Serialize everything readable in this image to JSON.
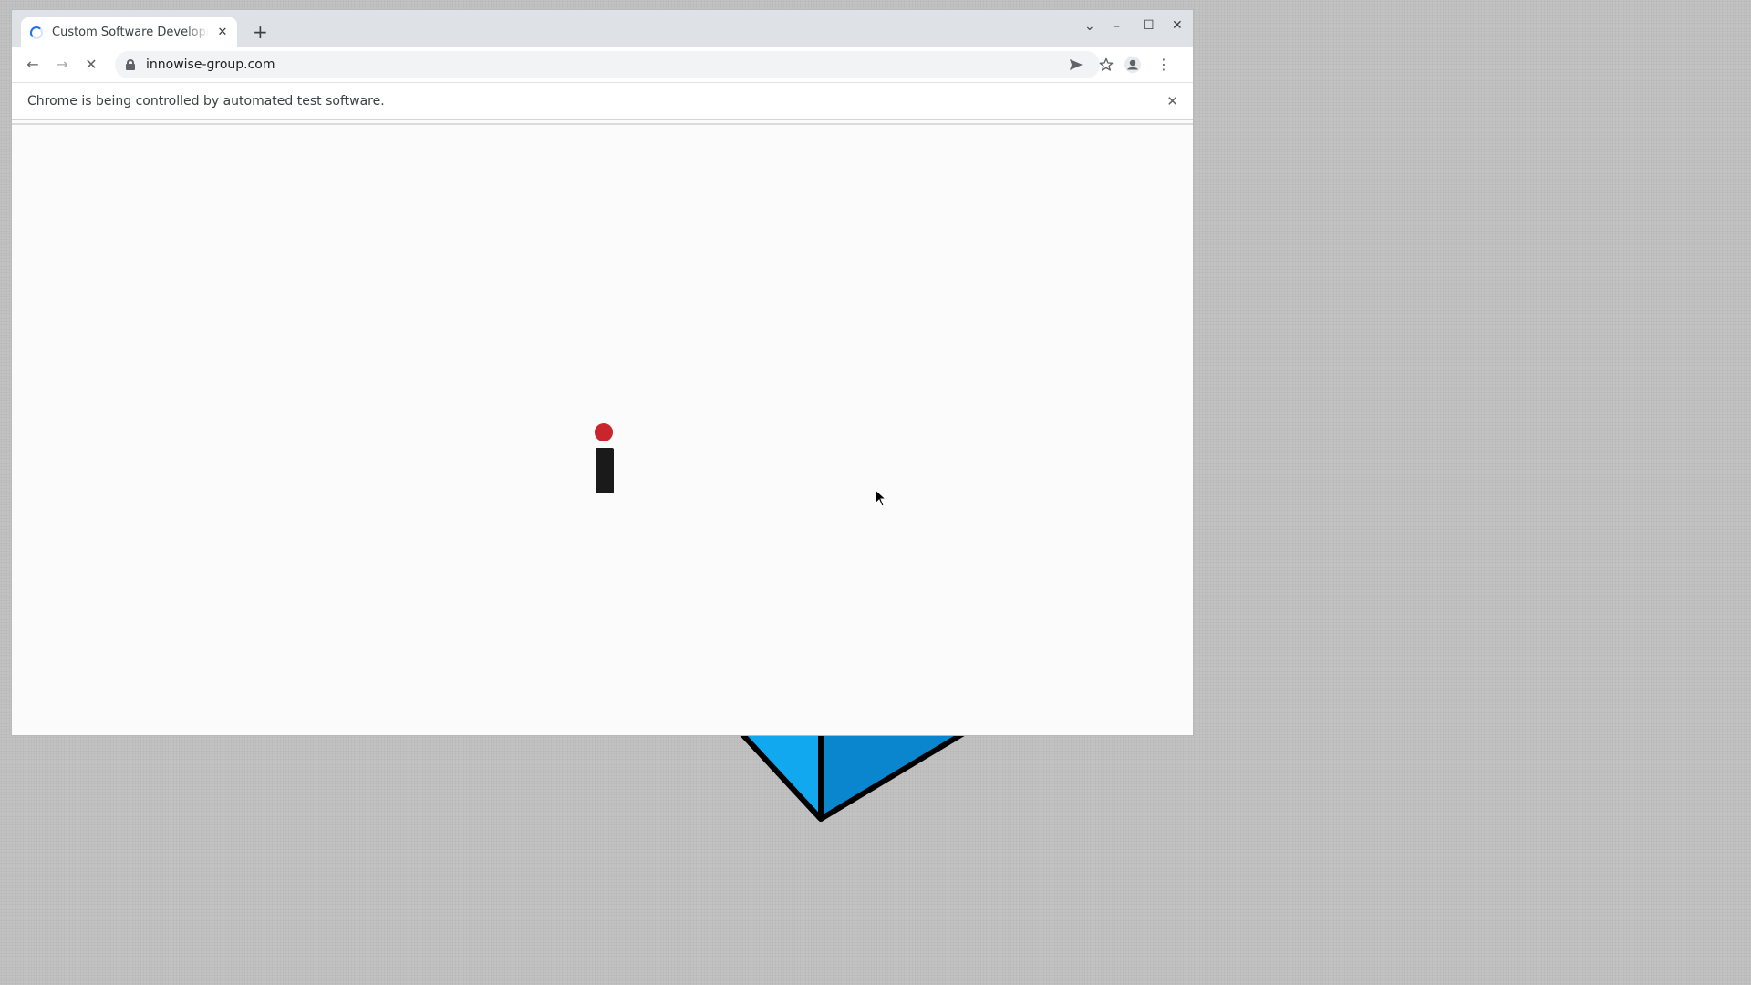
{
  "browser": {
    "tab": {
      "title": "Custom Software Development",
      "close_glyph": "✕"
    },
    "new_tab_glyph": "+",
    "window_controls": {
      "tab_search": "⌄",
      "minimize": "–",
      "maximize": "☐",
      "close": "✕"
    },
    "toolbar": {
      "back": "←",
      "forward": "→",
      "reload": "✕",
      "url": "innowise-group.com",
      "send_icon": "send-icon",
      "bookmark_icon": "star-icon",
      "profile_icon": "profile-icon",
      "menu_glyph": "⋮"
    },
    "infobar": {
      "text": "Chrome is being controlled by automated test software.",
      "close_glyph": "✕"
    }
  },
  "page": {
    "logo": {
      "dot_color": "#c8252c",
      "bar_color": "#1a1a1a"
    },
    "state": "loading"
  },
  "colors": {
    "accent": "#1a73e8",
    "desktop_shape_fill": "#0a9ee6"
  }
}
